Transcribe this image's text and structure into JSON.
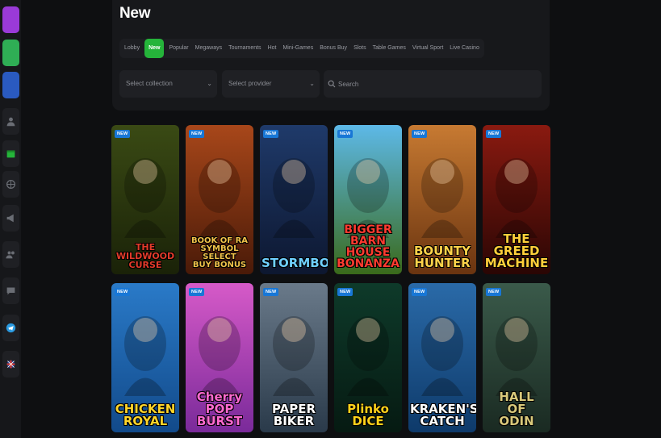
{
  "page": {
    "title": "New"
  },
  "tabs": [
    "Lobby",
    "New",
    "Popular",
    "Megaways",
    "Tournaments",
    "Hot",
    "Mini-Games",
    "Bonus Buy",
    "Slots",
    "Table Games",
    "Virtual Sport",
    "Live Casino"
  ],
  "active_tab": "New",
  "filters": {
    "collection_placeholder": "Select collection",
    "provider_placeholder": "Select provider",
    "search_placeholder": "Search"
  },
  "badge_label": "NEW",
  "games": [
    {
      "name": "The Wildwood Curse",
      "lines": [
        "THE WILDWOOD",
        "CURSE"
      ],
      "bg": "#3a4a14",
      "bg2": "#1a2208",
      "text": "#e23b2a"
    },
    {
      "name": "Book of Ra Symbol Select Buy Bonus",
      "lines": [
        "BOOK OF RA",
        "SYMBOL SELECT",
        "BUY BONUS"
      ],
      "bg": "#a8471a",
      "bg2": "#4a1a08",
      "text": "#f1c24a"
    },
    {
      "name": "Stormborn",
      "lines": [
        "STORMBORN"
      ],
      "bg": "#1f3a6a",
      "bg2": "#0d1730",
      "text": "#6fd0ff"
    },
    {
      "name": "Bigger Barn House Bonanza",
      "lines": [
        "BIGGER",
        "BARN HOUSE",
        "BONANZA"
      ],
      "bg": "#5db9e8",
      "bg2": "#3a6a1a",
      "text": "#ff3b30"
    },
    {
      "name": "Bounty Hunter",
      "lines": [
        "BOUNTY",
        "HUNTER"
      ],
      "bg": "#c77a32",
      "bg2": "#6a3410",
      "text": "#ffd34a"
    },
    {
      "name": "The Greed Machine",
      "lines": [
        "THE",
        "GREED",
        "MACHINE"
      ],
      "bg": "#8a1a10",
      "bg2": "#2a0604",
      "text": "#ffcf3a"
    },
    {
      "name": "Chicken Royal",
      "lines": [
        "CHICKEN",
        "ROYAL"
      ],
      "bg": "#2a7ac8",
      "bg2": "#124a8a",
      "text": "#ffd52a"
    },
    {
      "name": "Cherry Pop Burst",
      "lines": [
        "Cherry",
        "POP",
        "BURST"
      ],
      "bg": "#d65ac8",
      "bg2": "#7a2a9a",
      "text": "#ff6ad0"
    },
    {
      "name": "Paper Biker",
      "lines": [
        "PAPER",
        "BIKER"
      ],
      "bg": "#6a7a8a",
      "bg2": "#2a3a4a",
      "text": "#ffffff"
    },
    {
      "name": "Plinko Dice",
      "lines": [
        "Plinko",
        "DICE"
      ],
      "bg": "#0e3a2a",
      "bg2": "#061a12",
      "text": "#ffd21a"
    },
    {
      "name": "Kraken's Catch",
      "lines": [
        "KRAKEN'S",
        "CATCH"
      ],
      "bg": "#2a6aa8",
      "bg2": "#0e3a6a",
      "text": "#ffffff"
    },
    {
      "name": "Hall of Odin",
      "lines": [
        "HALL",
        "OF",
        "ODIN"
      ],
      "bg": "#3a5a4a",
      "bg2": "#1a2a22",
      "text": "#d8c87a"
    }
  ],
  "colors": {
    "accent": "#25b43a",
    "badge": "#1877d6",
    "panel": "#17181b",
    "bg": "#0e0f11"
  },
  "sidebar": {
    "items": [
      {
        "icon": "game-thumb-1-icon",
        "kind": "thumb",
        "color": "#9a3ad8"
      },
      {
        "icon": "game-thumb-2-icon",
        "kind": "thumb",
        "color": "#3ad86a"
      },
      {
        "icon": "game-thumb-3-icon",
        "kind": "thumb",
        "color": "#2a6ad8"
      },
      {
        "icon": "user-icon",
        "kind": "icon"
      },
      {
        "icon": "calendar-icon",
        "kind": "icon"
      },
      {
        "icon": "sports-ball-icon",
        "kind": "icon"
      },
      {
        "icon": "megaphone-icon",
        "kind": "icon"
      },
      {
        "icon": "users-icon",
        "kind": "icon"
      },
      {
        "icon": "chat-icon",
        "kind": "icon"
      },
      {
        "icon": "telegram-icon",
        "kind": "icon"
      },
      {
        "icon": "uk-flag-icon",
        "kind": "icon"
      }
    ]
  }
}
